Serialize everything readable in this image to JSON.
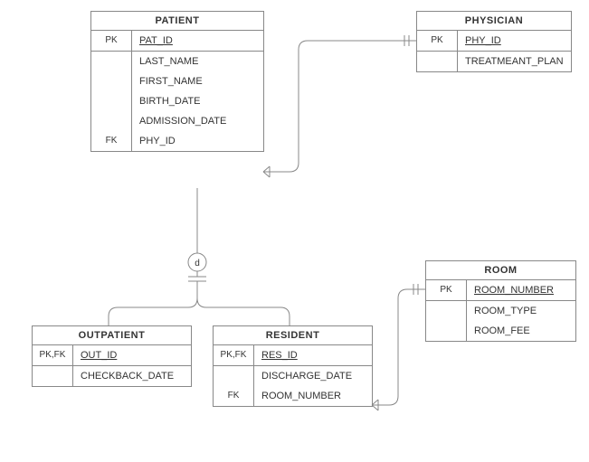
{
  "entities": {
    "patient": {
      "title": "PATIENT",
      "rows": [
        {
          "key": "PK",
          "attr": "PAT_ID",
          "pk": true
        },
        {
          "key": "",
          "attr": "LAST_NAME"
        },
        {
          "key": "",
          "attr": "FIRST_NAME"
        },
        {
          "key": "",
          "attr": "BIRTH_DATE"
        },
        {
          "key": "",
          "attr": "ADMISSION_DATE"
        },
        {
          "key": "FK",
          "attr": "PHY_ID"
        }
      ]
    },
    "physician": {
      "title": "PHYSICIAN",
      "rows": [
        {
          "key": "PK",
          "attr": "PHY_ID",
          "pk": true
        },
        {
          "key": "",
          "attr": "TREATMEANT_PLAN"
        }
      ]
    },
    "outpatient": {
      "title": "OUTPATIENT",
      "rows": [
        {
          "key": "PK,FK",
          "attr": "OUT_ID",
          "pk": true
        },
        {
          "key": "",
          "attr": "CHECKBACK_DATE"
        }
      ]
    },
    "resident": {
      "title": "RESIDENT",
      "rows": [
        {
          "key": "PK,FK",
          "attr": "RES_ID",
          "pk": true
        },
        {
          "key": "",
          "attr": "DISCHARGE_DATE"
        },
        {
          "key": "FK",
          "attr": "ROOM_NUMBER"
        }
      ]
    },
    "room": {
      "title": "ROOM",
      "rows": [
        {
          "key": "PK",
          "attr": "ROOM_NUMBER",
          "pk": true
        },
        {
          "key": "",
          "attr": "ROOM_TYPE"
        },
        {
          "key": "",
          "attr": "ROOM_FEE"
        }
      ]
    }
  },
  "disjoint_label": "d"
}
